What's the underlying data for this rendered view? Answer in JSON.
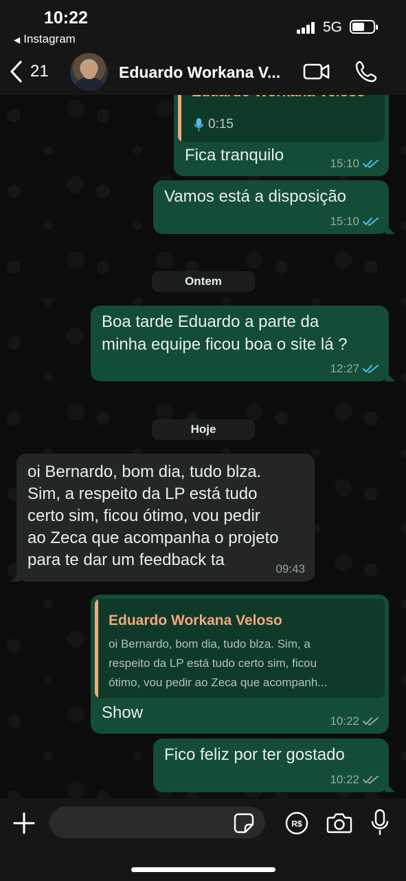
{
  "status_bar": {
    "time": "10:22",
    "back_app": "Instagram",
    "network": "5G"
  },
  "header": {
    "back_count": "21",
    "contact_name": "Eduardo Workana V..."
  },
  "messages": [
    {
      "direction": "out",
      "quote_author": "Eduardo Workana Veloso",
      "quote_audio_duration": "0:15",
      "text": "Fica tranquilo",
      "time": "15:10",
      "status": "read"
    },
    {
      "direction": "out",
      "text": "Vamos está a disposição",
      "time": "15:10",
      "status": "read"
    },
    {
      "day_separator": "Ontem"
    },
    {
      "direction": "out",
      "text_lines": [
        "Boa tarde Eduardo a parte da",
        "minha equipe ficou boa o site lá ?"
      ],
      "time": "12:27",
      "status": "read"
    },
    {
      "day_separator": "Hoje"
    },
    {
      "direction": "in",
      "text_lines": [
        "oi Bernardo, bom dia, tudo blza.",
        "Sim, a respeito da LP está tudo",
        "certo sim, ficou ótimo, vou pedir",
        "ao Zeca que acompanha o projeto",
        "para te dar um feedback ta"
      ],
      "time": "09:43"
    },
    {
      "direction": "out",
      "quote_author": "Eduardo Workana Veloso",
      "quote_lines": [
        "oi Bernardo, bom dia, tudo blza. Sim, a",
        "respeito da LP está tudo certo sim, ficou",
        "ótimo, vou pedir ao Zeca que acompanh..."
      ],
      "text": "Show",
      "time": "10:22",
      "status": "delivered"
    },
    {
      "direction": "out",
      "text": "Fico feliz por ter gostado",
      "time": "10:22",
      "status": "delivered"
    }
  ],
  "composer": {
    "placeholder": ""
  },
  "colors": {
    "outgoing_bubble": "#134d37",
    "incoming_bubble": "#242626",
    "quote_accent": "#f4a77d",
    "read_ticks": "#53bdeb",
    "delivered_ticks": "#9aa5a0"
  },
  "icons": [
    "back-chevron-icon",
    "video-call-icon",
    "phone-icon",
    "plus-icon",
    "sticker-icon",
    "pay-icon",
    "camera-icon",
    "mic-icon",
    "microphone-audio-icon"
  ]
}
